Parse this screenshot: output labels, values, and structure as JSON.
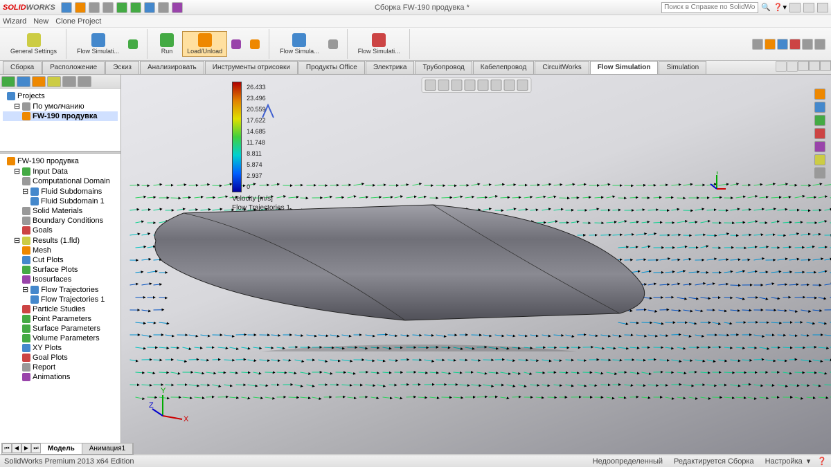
{
  "app": {
    "brand_pre": "SOLID",
    "brand_post": "WORKS",
    "title": "Сборка FW-190 продувка *"
  },
  "menubar": {
    "item1": "Wizard",
    "item2": "New",
    "item3": "Clone Project"
  },
  "search": {
    "placeholder": "Поиск в Справке по SolidWorks"
  },
  "ribbon": {
    "general_settings": "General\nSettings",
    "flow_sim1": "Flow\nSimulati...",
    "run": "Run",
    "load_unload": "Load/Unload",
    "flow_sim2": "Flow\nSimula...",
    "flow_sim3": "Flow\nSimulati..."
  },
  "tabs": [
    "Сборка",
    "Расположение",
    "Эскиз",
    "Анализировать",
    "Инструменты отрисовки",
    "Продукты Office",
    "Электрика",
    "Трубопровод",
    "Кабелепровод",
    "CircuitWorks",
    "Flow Simulation",
    "Simulation"
  ],
  "active_tab": "Flow Simulation",
  "tree_top": {
    "projects": "Projects",
    "default": "По умолчанию",
    "fw190": "FW-190 продувка"
  },
  "tree_bottom": {
    "root": "FW-190 продувка",
    "input_data": "Input Data",
    "comp_domain": "Computational Domain",
    "fluid_subdomains": "Fluid Subdomains",
    "fluid_subdomain1": "Fluid Subdomain 1",
    "solid_materials": "Solid Materials",
    "boundary_cond": "Boundary Conditions",
    "goals": "Goals",
    "results": "Results (1.fld)",
    "mesh": "Mesh",
    "cut_plots": "Cut Plots",
    "surface_plots": "Surface Plots",
    "isosurfaces": "Isosurfaces",
    "flow_traj": "Flow Trajectories",
    "flow_traj1": "Flow Trajectories 1",
    "particle": "Particle Studies",
    "point_params": "Point Parameters",
    "surface_params": "Surface Parameters",
    "volume_params": "Volume Parameters",
    "xy_plots": "XY Plots",
    "goal_plots": "Goal Plots",
    "report": "Report",
    "animations": "Animations"
  },
  "legend": {
    "v0": "26.433",
    "v1": "23.496",
    "v2": "20.559",
    "v3": "17.622",
    "v4": "14.685",
    "v5": "11.748",
    "v6": "8.811",
    "v7": "5.874",
    "v8": "2.937",
    "v9": "0",
    "title": "Velocity [m/s]",
    "subtitle": "Flow Trajectories 1"
  },
  "bottom_tabs": {
    "model": "Модель",
    "anim": "Анимация1"
  },
  "status": {
    "edition": "SolidWorks Premium 2013 x64 Edition",
    "s1": "Недоопределенный",
    "s2": "Редактируется Сборка",
    "s3": "Настройка"
  }
}
